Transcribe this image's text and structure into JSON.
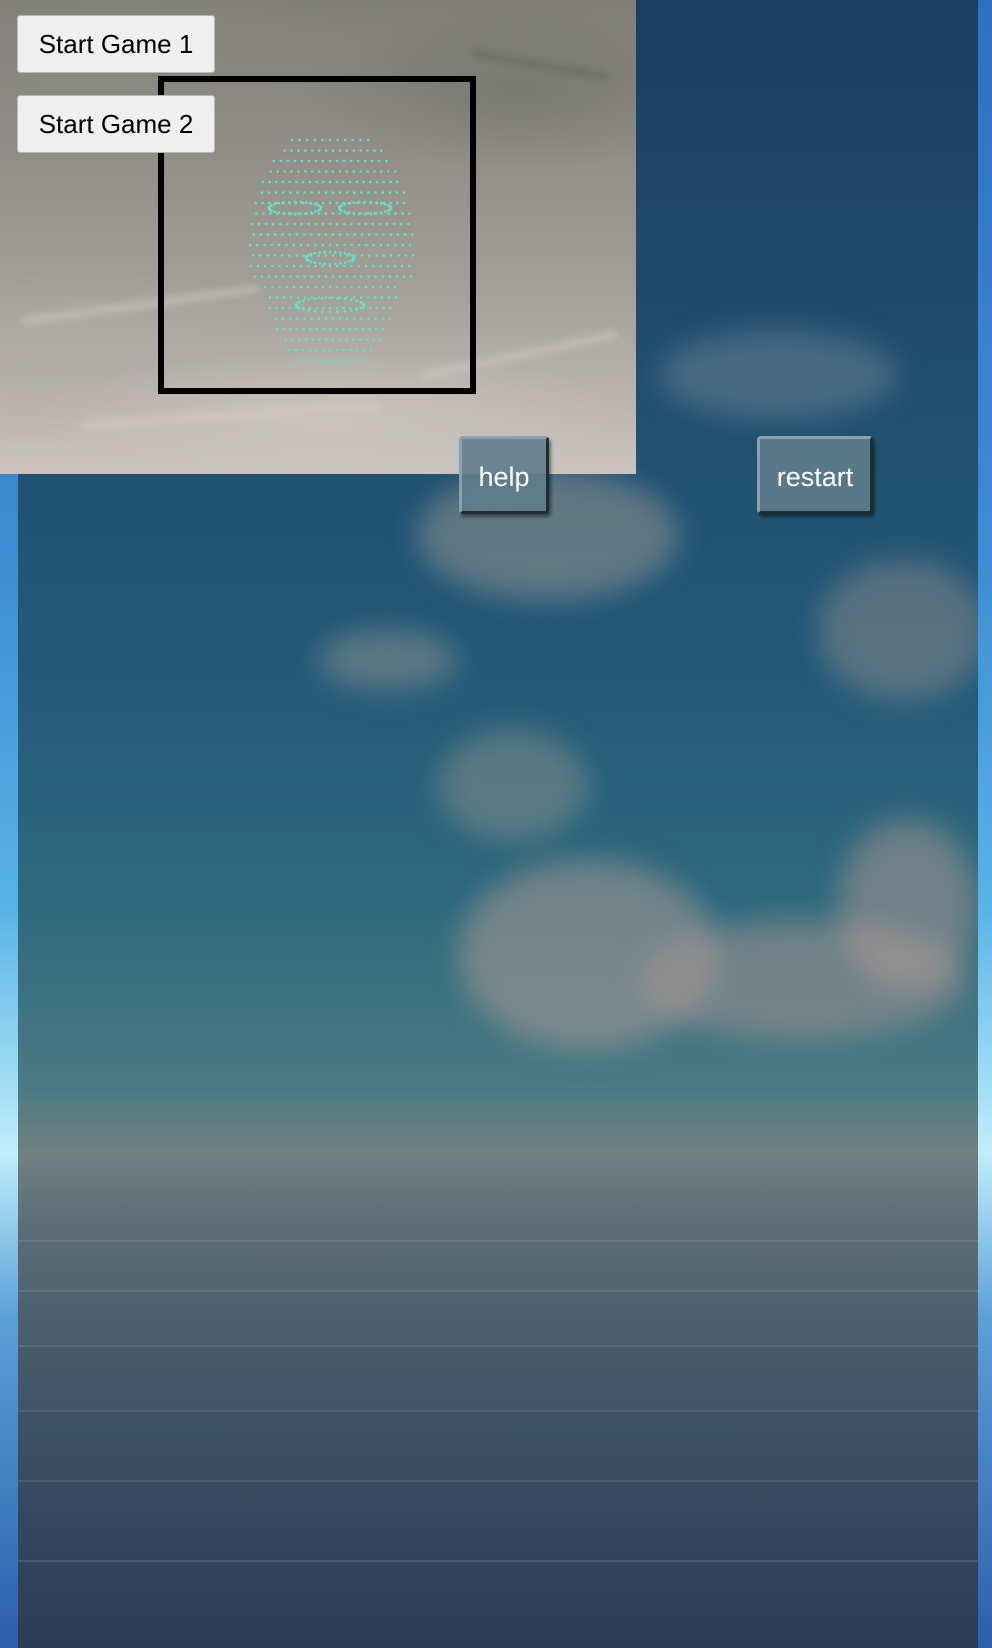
{
  "controls": {
    "start_game_1": "Start Game 1",
    "start_game_2": "Start Game 2",
    "help": "help",
    "restart": "restart"
  },
  "colors": {
    "face_box": "#000000",
    "face_mesh": "#5fe3c8",
    "button_face": "#5f7d8c"
  }
}
